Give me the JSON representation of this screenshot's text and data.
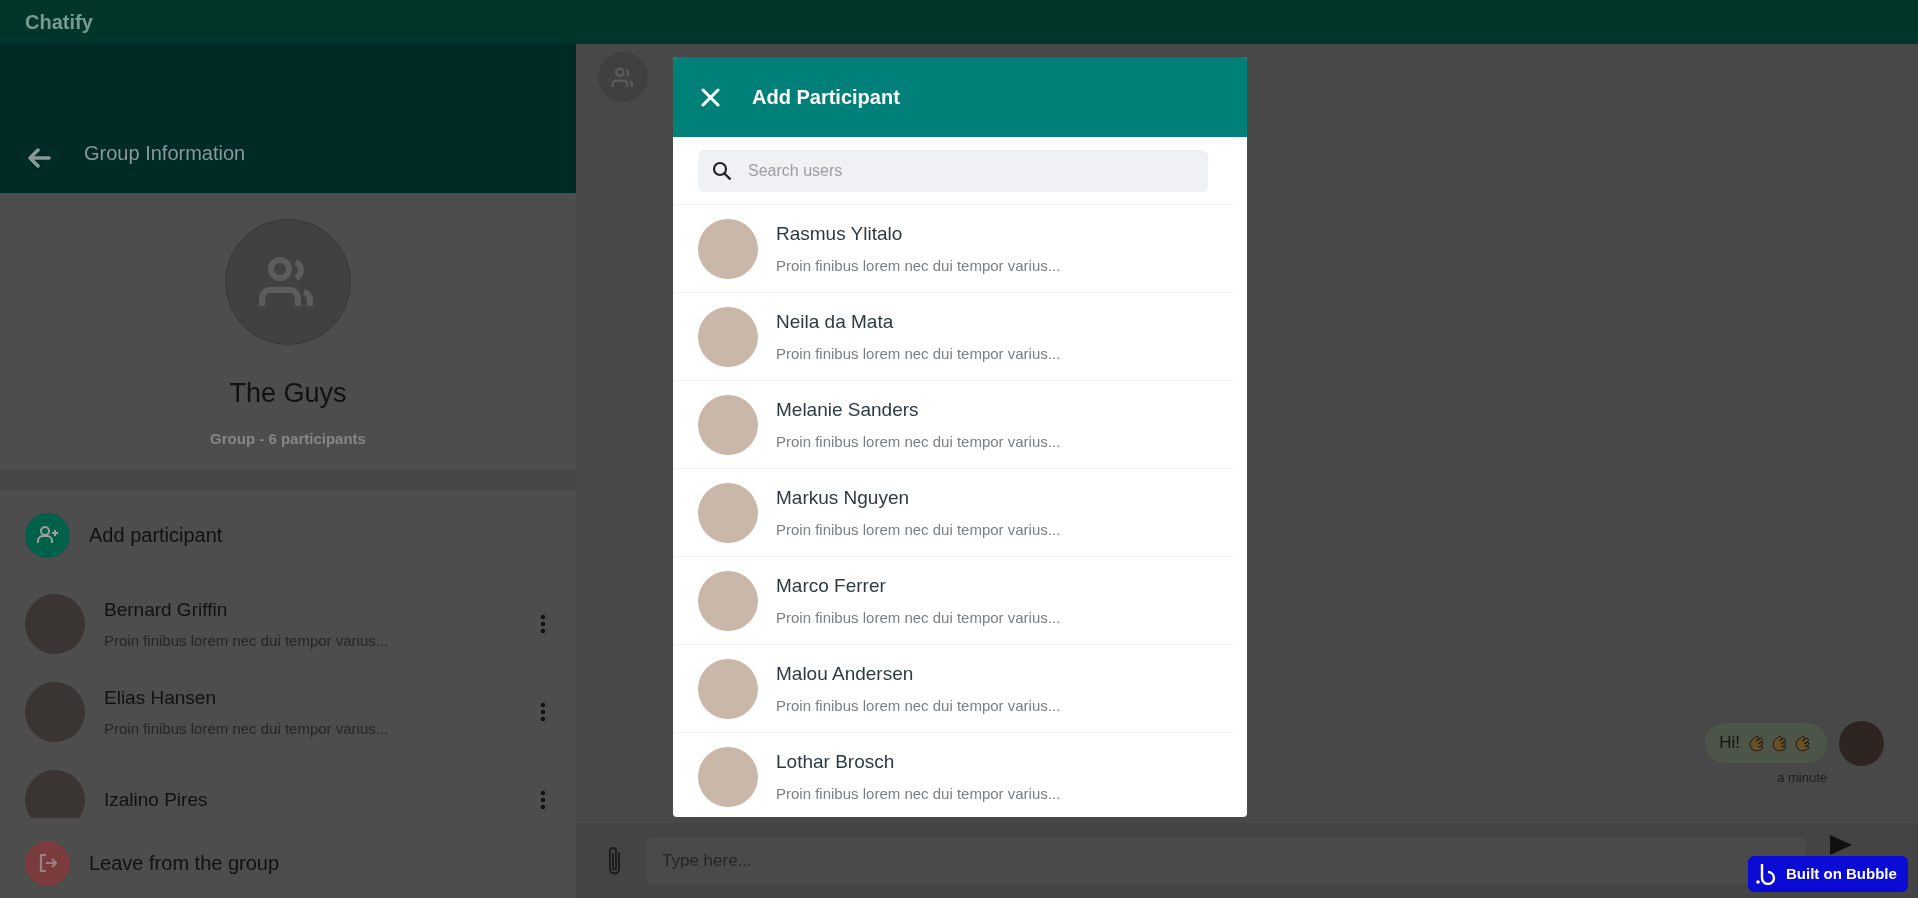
{
  "app": {
    "title": "Chatify"
  },
  "group_panel": {
    "header": {
      "title": "Group Information"
    },
    "name": "The Guys",
    "subtitle": "Group - 6 participants",
    "add_action": "Add participant",
    "members": [
      {
        "name": "Bernard Griffin",
        "preview": "Proin finibus lorem nec dui tempor varius..."
      },
      {
        "name": "Elias Hansen",
        "preview": "Proin finibus lorem nec dui tempor varius..."
      },
      {
        "name": "Izalino Pires"
      }
    ],
    "leave_action": "Leave from the group"
  },
  "chat": {
    "messages": [
      {
        "text": "Hi!",
        "time": "a minute"
      }
    ],
    "input": {
      "placeholder": "Type here..."
    }
  },
  "modal": {
    "title": "Add Participant",
    "search": {
      "placeholder": "Search users"
    },
    "users": [
      {
        "name": "Rasmus Ylitalo",
        "preview": "Proin finibus lorem nec dui tempor varius..."
      },
      {
        "name": "Neila da Mata",
        "preview": "Proin finibus lorem nec dui tempor varius..."
      },
      {
        "name": "Melanie Sanders",
        "preview": "Proin finibus lorem nec dui tempor varius..."
      },
      {
        "name": "Markus Nguyen",
        "preview": "Proin finibus lorem nec dui tempor varius..."
      },
      {
        "name": "Marco Ferrer",
        "preview": "Proin finibus lorem nec dui tempor varius..."
      },
      {
        "name": "Malou Andersen",
        "preview": "Proin finibus lorem nec dui tempor varius..."
      },
      {
        "name": "Lothar Brosch",
        "preview": "Proin finibus lorem nec dui tempor varius..."
      }
    ]
  },
  "badge": {
    "label": "Built on Bubble"
  }
}
